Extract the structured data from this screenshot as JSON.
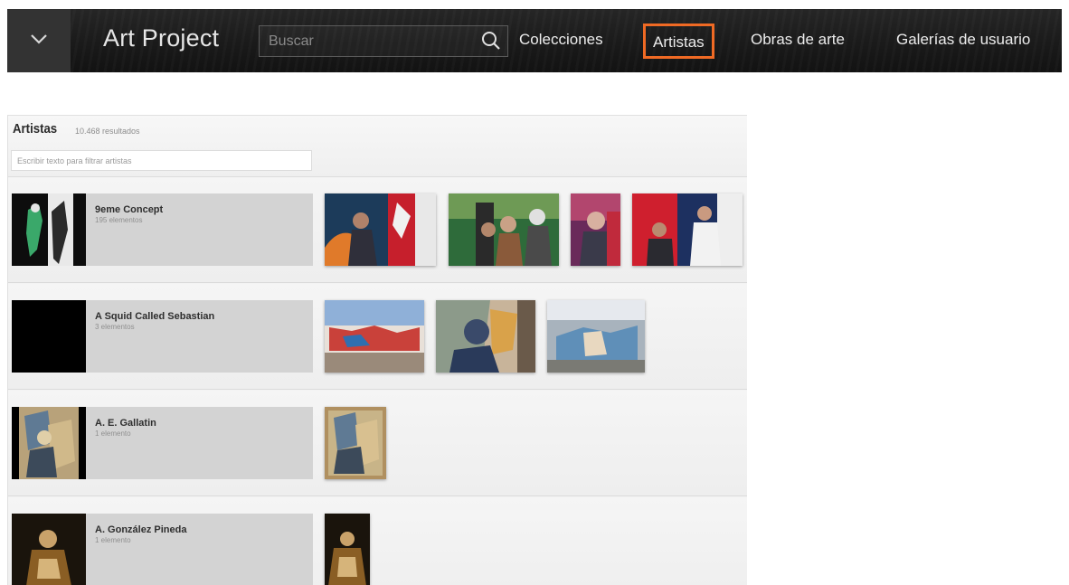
{
  "header": {
    "app_title": "Art Project",
    "menu_icon": "chevron-down-icon",
    "search": {
      "placeholder": "Buscar",
      "value": "",
      "icon": "search-icon"
    },
    "nav": [
      {
        "label": "Colecciones",
        "active": false
      },
      {
        "label": "Artistas",
        "active": true
      },
      {
        "label": "Obras de arte",
        "active": false
      },
      {
        "label": "Galerías de usuario",
        "active": false
      }
    ],
    "accent_color": "#f06a24"
  },
  "artists_panel": {
    "title": "Artistas",
    "result_count": "10.468 resultados",
    "filter": {
      "placeholder": "Escribir texto para filtrar artistas",
      "value": ""
    },
    "artists": [
      {
        "name": "9eme Concept",
        "count": "195 elementos",
        "artworks_shown": 4
      },
      {
        "name": "A Squid Called Sebastian",
        "count": "3 elementos",
        "artworks_shown": 3
      },
      {
        "name": "A. E. Gallatin",
        "count": "1 elemento",
        "artworks_shown": 1
      },
      {
        "name": "A. González Pineda",
        "count": "1 elemento",
        "artworks_shown": 1
      }
    ]
  }
}
